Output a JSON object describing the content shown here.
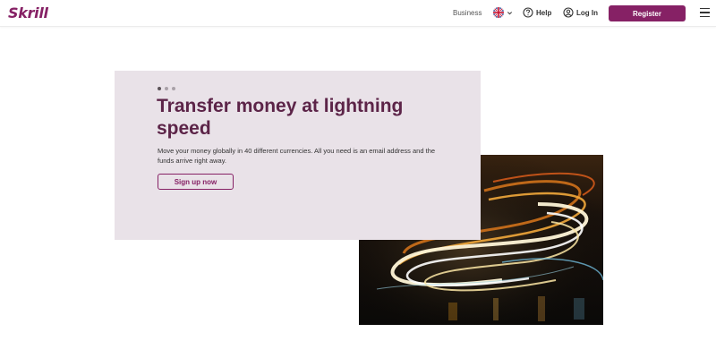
{
  "header": {
    "logo_text": "Skrill",
    "business_label": "Business",
    "help_label": "Help",
    "login_label": "Log In",
    "register_label": "Register"
  },
  "hero": {
    "slide_indicators": 3,
    "active_slide": 1,
    "title": "Transfer money at lightning speed",
    "description": "Move your money globally in 40 different currencies. All you need is an email address and the funds arrive right away.",
    "cta_label": "Sign up now"
  },
  "colors": {
    "brand": "#862165",
    "headline": "#5c2448",
    "card_background": "#e9e2e8"
  },
  "icons": [
    "globe-flag-icon",
    "chevron-down-icon",
    "help-circle-icon",
    "user-circle-icon",
    "hamburger-menu-icon"
  ]
}
